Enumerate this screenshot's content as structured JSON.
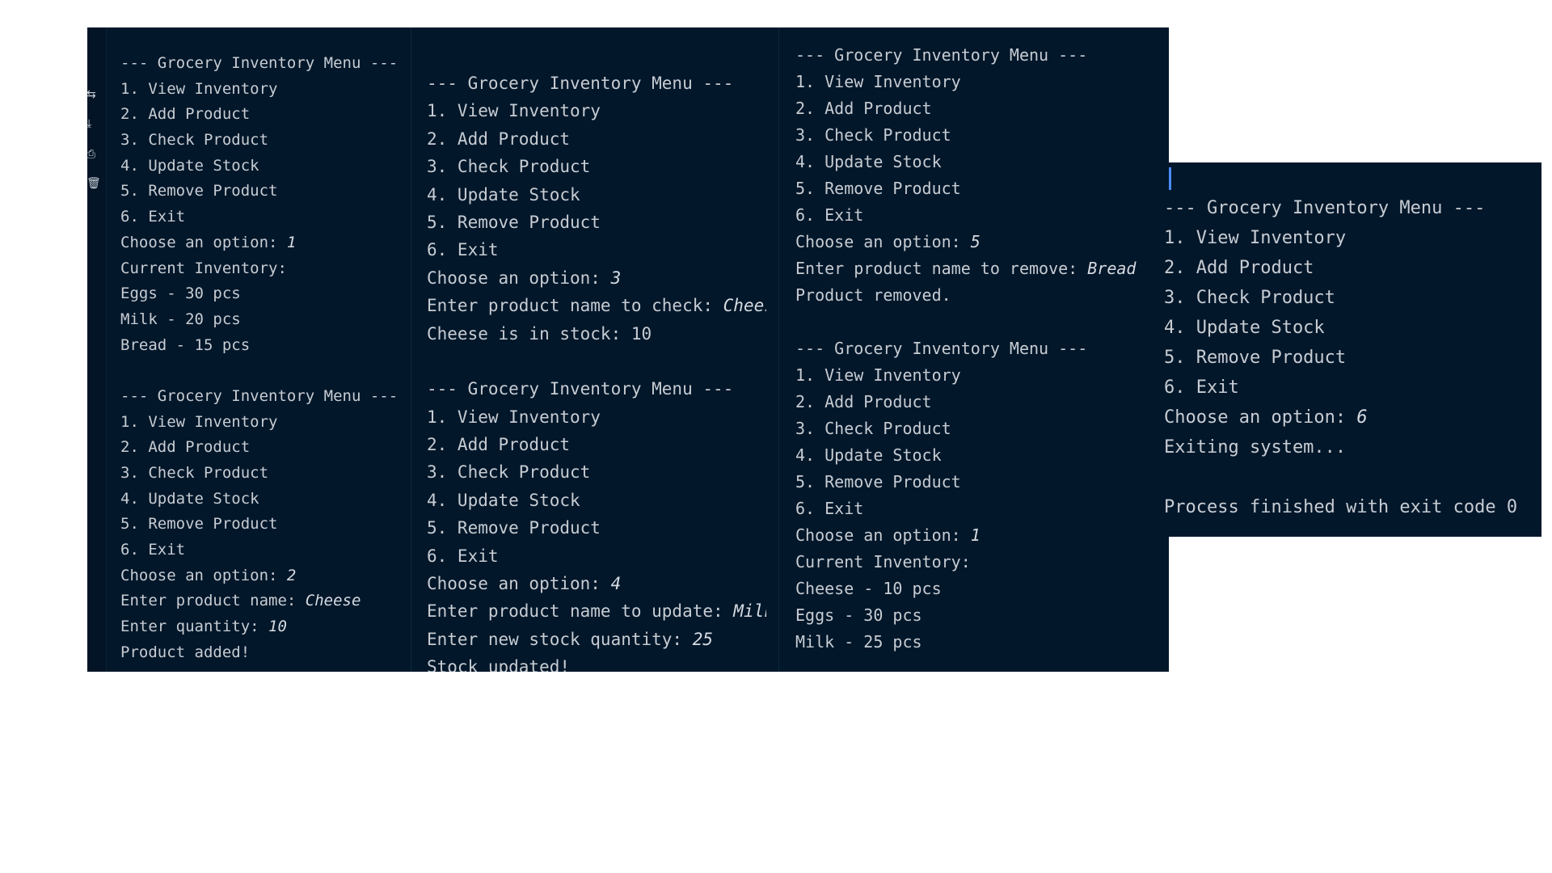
{
  "window": {
    "colors": {
      "background": "#02172a",
      "text": "#c7ccd3",
      "cursor": "#4a8cff"
    }
  },
  "gutter": {
    "icons": [
      "format-icon",
      "download-icon",
      "print-icon",
      "trash-icon"
    ]
  },
  "panels": [
    {
      "lines": [
        {
          "text": "--- Grocery Inventory Menu ---"
        },
        {
          "text": "1. View Inventory"
        },
        {
          "text": "2. Add Product"
        },
        {
          "text": "3. Check Product"
        },
        {
          "text": "4. Update Stock"
        },
        {
          "text": "5. Remove Product"
        },
        {
          "text": "6. Exit"
        },
        {
          "text": "Choose an option: ",
          "input": "1"
        },
        {
          "text": "Current Inventory:"
        },
        {
          "text": "Eggs - 30 pcs"
        },
        {
          "text": "Milk - 20 pcs"
        },
        {
          "text": "Bread - 15 pcs"
        },
        {
          "text": ""
        },
        {
          "text": "--- Grocery Inventory Menu ---"
        },
        {
          "text": "1. View Inventory"
        },
        {
          "text": "2. Add Product"
        },
        {
          "text": "3. Check Product"
        },
        {
          "text": "4. Update Stock"
        },
        {
          "text": "5. Remove Product"
        },
        {
          "text": "6. Exit"
        },
        {
          "text": "Choose an option: ",
          "input": "2"
        },
        {
          "text": "Enter product name: ",
          "input": "Cheese"
        },
        {
          "text": "Enter quantity: ",
          "input": "10"
        },
        {
          "text": "Product added!"
        }
      ]
    },
    {
      "lines": [
        {
          "text": "--- Grocery Inventory Menu ---"
        },
        {
          "text": "1. View Inventory"
        },
        {
          "text": "2. Add Product"
        },
        {
          "text": "3. Check Product"
        },
        {
          "text": "4. Update Stock"
        },
        {
          "text": "5. Remove Product"
        },
        {
          "text": "6. Exit"
        },
        {
          "text": "Choose an option: ",
          "input": "3"
        },
        {
          "text": "Enter product name to check: ",
          "input": "Cheese"
        },
        {
          "text": "Cheese is in stock: 10"
        },
        {
          "text": ""
        },
        {
          "text": "--- Grocery Inventory Menu ---"
        },
        {
          "text": "1. View Inventory"
        },
        {
          "text": "2. Add Product"
        },
        {
          "text": "3. Check Product"
        },
        {
          "text": "4. Update Stock"
        },
        {
          "text": "5. Remove Product"
        },
        {
          "text": "6. Exit"
        },
        {
          "text": "Choose an option: ",
          "input": "4"
        },
        {
          "text": "Enter product name to update: ",
          "input": "Milk"
        },
        {
          "text": "Enter new stock quantity: ",
          "input": "25"
        },
        {
          "text": "Stock updated!"
        }
      ]
    },
    {
      "lines": [
        {
          "text": "--- Grocery Inventory Menu ---"
        },
        {
          "text": "1. View Inventory"
        },
        {
          "text": "2. Add Product"
        },
        {
          "text": "3. Check Product"
        },
        {
          "text": "4. Update Stock"
        },
        {
          "text": "5. Remove Product"
        },
        {
          "text": "6. Exit"
        },
        {
          "text": "Choose an option: ",
          "input": "5"
        },
        {
          "text": "Enter product name to remove: ",
          "input": "Bread"
        },
        {
          "text": "Product removed."
        },
        {
          "text": ""
        },
        {
          "text": "--- Grocery Inventory Menu ---"
        },
        {
          "text": "1. View Inventory"
        },
        {
          "text": "2. Add Product"
        },
        {
          "text": "3. Check Product"
        },
        {
          "text": "4. Update Stock"
        },
        {
          "text": "5. Remove Product"
        },
        {
          "text": "6. Exit"
        },
        {
          "text": "Choose an option: ",
          "input": "1"
        },
        {
          "text": "Current Inventory:"
        },
        {
          "text": "Cheese - 10 pcs"
        },
        {
          "text": "Eggs - 30 pcs"
        },
        {
          "text": "Milk - 25 pcs"
        }
      ]
    },
    {
      "lines": [
        {
          "text": "--- Grocery Inventory Menu ---"
        },
        {
          "text": "1. View Inventory"
        },
        {
          "text": "2. Add Product"
        },
        {
          "text": "3. Check Product"
        },
        {
          "text": "4. Update Stock"
        },
        {
          "text": "5. Remove Product"
        },
        {
          "text": "6. Exit"
        },
        {
          "text": "Choose an option: ",
          "input": "6"
        },
        {
          "text": "Exiting system..."
        },
        {
          "text": ""
        },
        {
          "text": "Process finished with exit code 0"
        }
      ]
    }
  ]
}
